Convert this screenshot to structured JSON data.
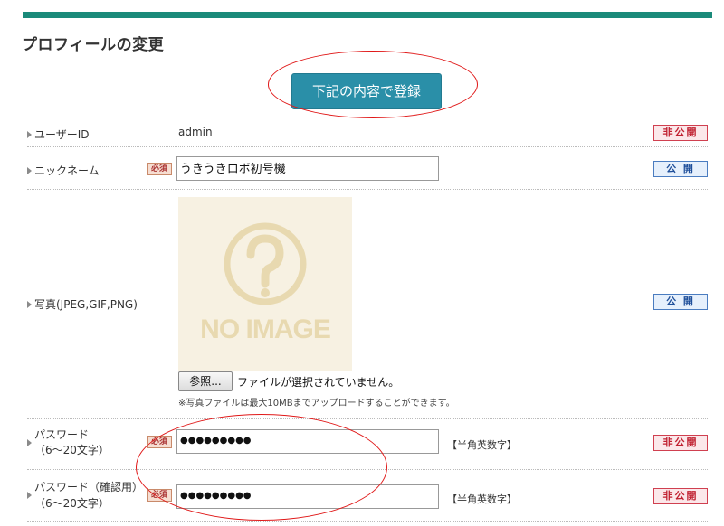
{
  "page": {
    "title": "プロフィールの変更"
  },
  "submit": {
    "label": "下記の内容で登録"
  },
  "fields": {
    "user_id": {
      "label": "ユーザーID",
      "value": "admin",
      "visibility": "非公開"
    },
    "nickname": {
      "label": "ニックネーム",
      "required": "必須",
      "value": "うきうきロボ初号機",
      "visibility": "公 開"
    },
    "photo": {
      "label": "写真(JPEG,GIF,PNG)",
      "placeholder_text": "NO IMAGE",
      "browse_label": "参照...",
      "file_status": "ファイルが選択されていません。",
      "note": "※写真ファイルは最大10MBまでアップロードすることができます。",
      "visibility": "公 開"
    },
    "password": {
      "label": "パスワード",
      "sublabel": "（6～20文字）",
      "required": "必須",
      "value": "●●●●●●●●●",
      "hint": "【半角英数字】",
      "visibility": "非公開"
    },
    "password_confirm": {
      "label": "パスワード（確認用）",
      "sublabel": "（6～20文字）",
      "required": "必須",
      "value": "●●●●●●●●●",
      "hint": "【半角英数字】",
      "visibility": "非公開"
    }
  },
  "colors": {
    "accent": "#1a8a7a",
    "button": "#2a8fa8",
    "annotation": "#e01818"
  }
}
